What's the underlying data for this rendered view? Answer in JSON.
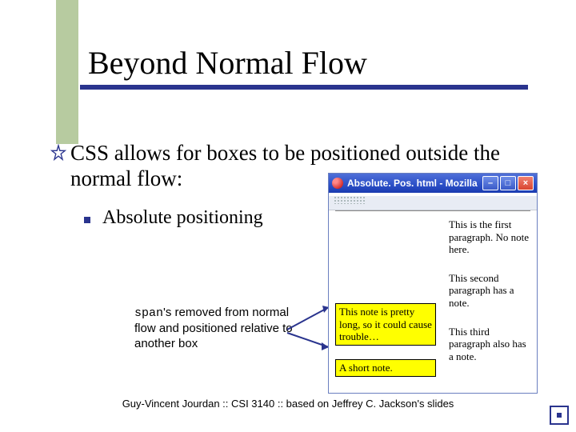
{
  "title": "Beyond Normal Flow",
  "main_bullet": "CSS allows for boxes to be positioned outside the normal flow:",
  "sub_bullet": "Absolute positioning",
  "caption": {
    "code": "span",
    "rest": "'s removed from normal flow and positioned relative to another box"
  },
  "browser": {
    "window_title": "Absolute. Pos. html - Mozilla",
    "paragraphs": [
      "This is the first paragraph. No note here.",
      "This second paragraph has a note.",
      "This third paragraph also has a note."
    ],
    "notes": [
      "This note is pretty long, so it could cause trouble…",
      "A short note."
    ]
  },
  "footer": "Guy-Vincent Jourdan :: CSI 3140 :: based on Jeffrey C. Jackson's slides"
}
